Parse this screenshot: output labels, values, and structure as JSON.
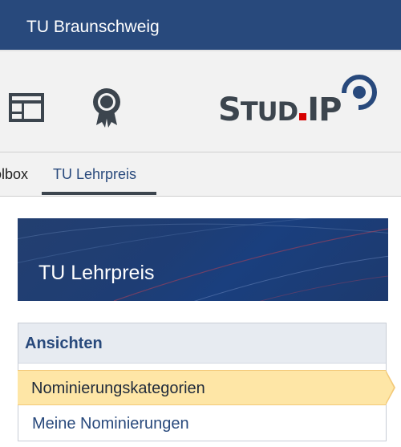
{
  "header": {
    "organization": "TU Braunschweig"
  },
  "navbar": {
    "icons": [
      "workplace-icon",
      "award-icon"
    ],
    "logo_text": "STUD.IP"
  },
  "tabs": [
    {
      "label": "olbox",
      "active": false
    },
    {
      "label": "TU Lehrpreis",
      "active": true
    }
  ],
  "banner": {
    "title": "TU Lehrpreis"
  },
  "sidebar": {
    "heading": "Ansichten",
    "items": [
      {
        "label": "Nominierungskategorien",
        "active": true
      },
      {
        "label": "Meine Nominierungen",
        "active": false
      }
    ]
  },
  "colors": {
    "brand": "#28497c",
    "active_item": "#fee6a6",
    "logo_dot": "#d60000"
  }
}
